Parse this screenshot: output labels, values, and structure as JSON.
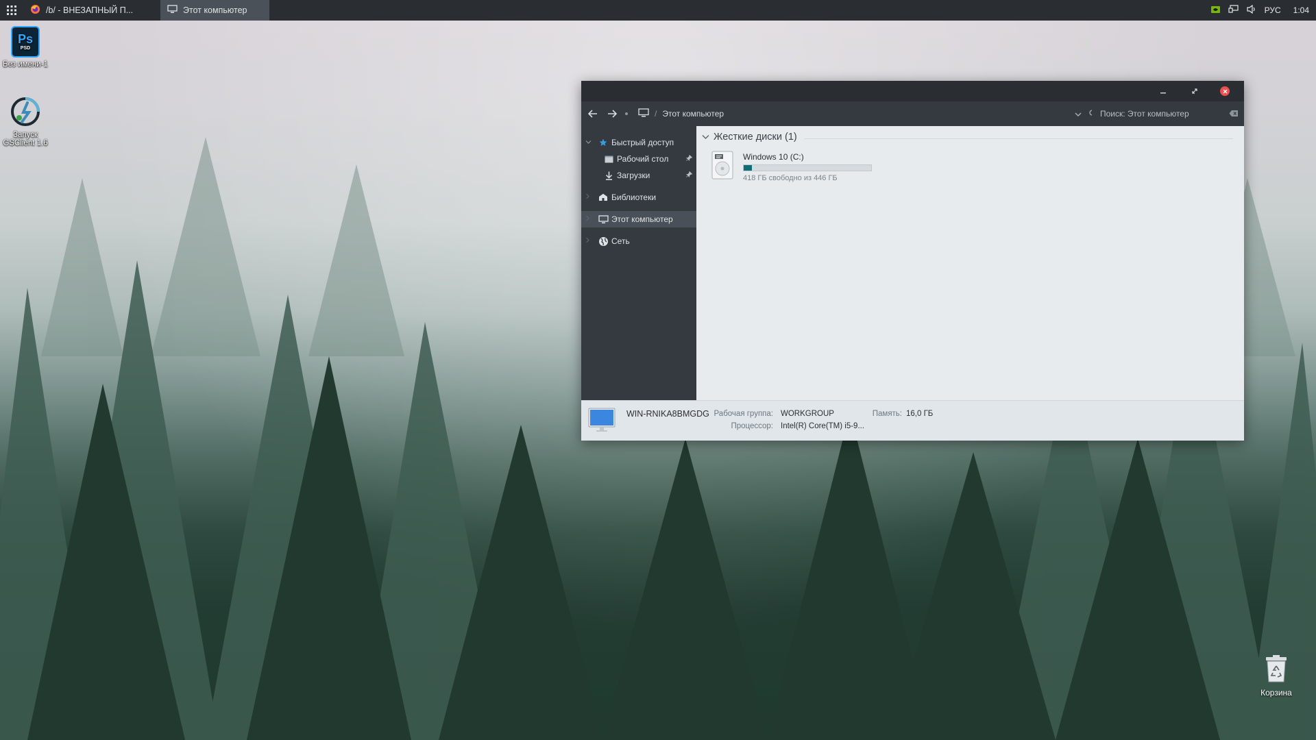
{
  "taskbar": {
    "start_icon": "apps-grid-icon",
    "tasks": [
      {
        "label": "/b/ - ВНЕЗАПНЫЙ П...",
        "icon": "firefox-icon"
      },
      {
        "label": "Этот компьютер",
        "icon": "computer-icon"
      }
    ],
    "tray": {
      "language": "РУС",
      "time": "1:04",
      "icons": [
        "nvidia-icon",
        "network-icon",
        "volume-icon"
      ]
    }
  },
  "desktop": {
    "icons": [
      {
        "label": "Без имени-1",
        "icon": "photoshop-psd-icon",
        "badge_main": "Ps",
        "badge_sub": "PSD"
      },
      {
        "label": "Запуск GSClient 1.6",
        "icon": "gsclient-icon"
      }
    ],
    "recycle_bin": {
      "label": "Корзина",
      "icon": "recycle-bin-icon"
    }
  },
  "explorer": {
    "title_buttons": [
      "minimize",
      "maximize",
      "close"
    ],
    "address": {
      "path_separator": "/",
      "location": "Этот компьютер"
    },
    "search_placeholder": "Поиск: Этот компьютер",
    "sidebar": {
      "quick_access": "Быстрый доступ",
      "desktop": "Рабочий стол",
      "downloads": "Загрузки",
      "libraries": "Библиотеки",
      "this_pc": "Этот компьютер",
      "network": "Сеть"
    },
    "group": {
      "title": "Жесткие диски (1)"
    },
    "drive": {
      "name": "Windows 10 (C:)",
      "free_text": "418 ГБ свободно из 446 ГБ",
      "used_fraction": 0.063
    },
    "details": {
      "computer_name": "WIN-RNIKA8BMGDG",
      "workgroup_label": "Рабочая группа:",
      "workgroup_value": "WORKGROUP",
      "memory_label": "Память:",
      "memory_value": "16,0 ГБ",
      "processor_label": "Процессор:",
      "processor_value": "Intel(R) Core(TM) i5-9..."
    }
  },
  "colors": {
    "taskbar_bg": "#2a2e33",
    "sidebar_bg": "#353a40",
    "content_bg": "#e7ebee",
    "drive_bar": "#0e6e78",
    "close_button": "#e8514f"
  }
}
